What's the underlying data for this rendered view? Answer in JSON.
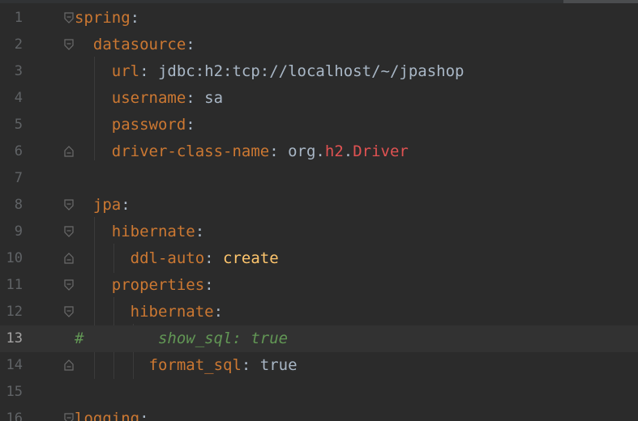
{
  "lines": [
    {
      "n": "1",
      "parts": [
        "spring",
        ":"
      ]
    },
    {
      "n": "2",
      "parts": [
        "  datasource",
        ":"
      ]
    },
    {
      "n": "3",
      "parts": [
        "    url",
        ": ",
        "jdbc:h2:tcp://localhost/~/jpashop"
      ]
    },
    {
      "n": "4",
      "parts": [
        "    username",
        ": ",
        "sa"
      ]
    },
    {
      "n": "5",
      "parts": [
        "    password",
        ":"
      ]
    },
    {
      "n": "6",
      "parts": [
        "    driver-class-name",
        ": ",
        "org.",
        "h2",
        ".",
        "Driver"
      ]
    },
    {
      "n": "7",
      "parts": []
    },
    {
      "n": "8",
      "parts": [
        "  jpa",
        ":"
      ]
    },
    {
      "n": "9",
      "parts": [
        "    hibernate",
        ":"
      ]
    },
    {
      "n": "10",
      "parts": [
        "      ddl-auto",
        ": ",
        "create"
      ]
    },
    {
      "n": "11",
      "parts": [
        "    properties",
        ":"
      ]
    },
    {
      "n": "12",
      "parts": [
        "      hibernate",
        ":"
      ]
    },
    {
      "n": "13",
      "parts": [
        "#",
        "        show_sql: true"
      ]
    },
    {
      "n": "14",
      "parts": [
        "        format_sql",
        ": ",
        "true"
      ]
    },
    {
      "n": "15",
      "parts": []
    },
    {
      "n": "16",
      "parts": [
        "logging",
        ":"
      ]
    }
  ],
  "colors": {
    "background": "#2b2b2b",
    "key": "#cc7832",
    "value": "#a9b7c6",
    "keyword_value": "#ffc66d",
    "comment": "#629755",
    "error": "#e05252"
  }
}
